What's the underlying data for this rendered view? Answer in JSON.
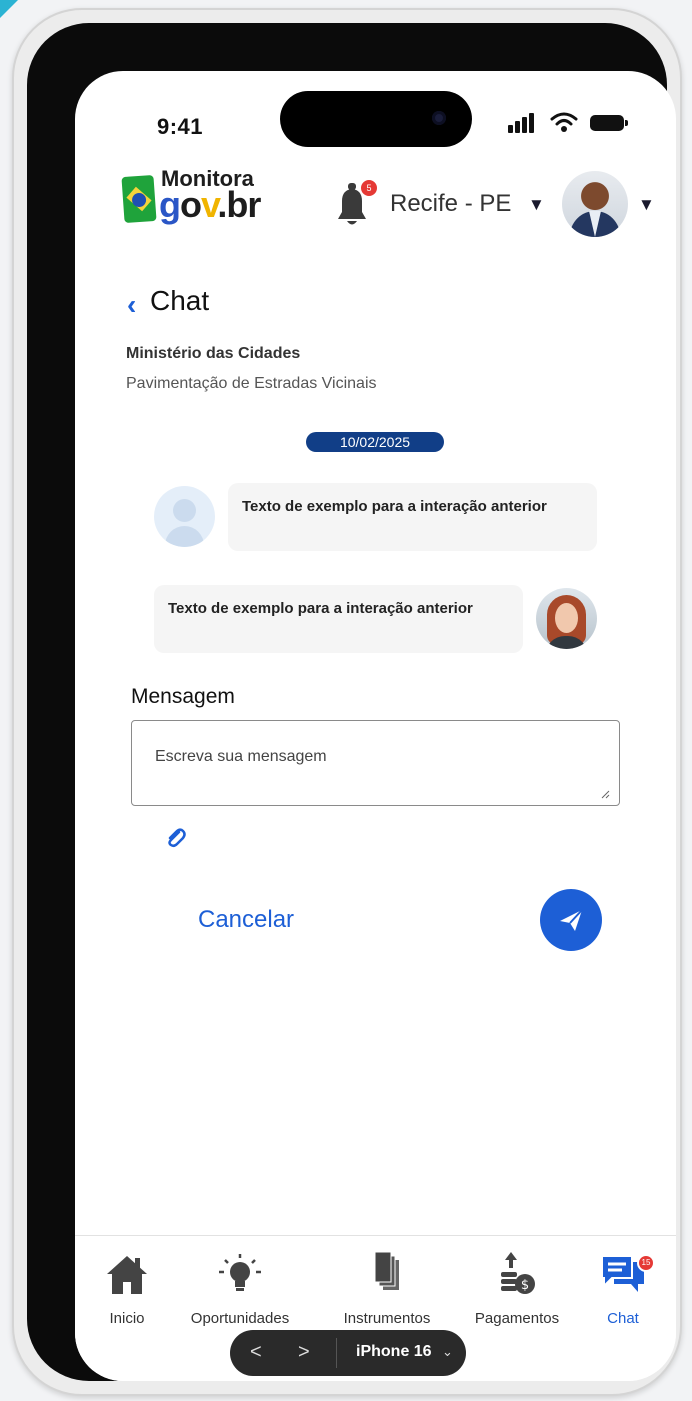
{
  "status_bar": {
    "time": "9:41"
  },
  "header": {
    "logo_top": "Monitora",
    "logo_g": "g",
    "logo_o": "o",
    "logo_v": "v",
    "logo_br": ".br",
    "notification_count": "5",
    "location": "Recife - PE"
  },
  "page": {
    "back_icon": "‹",
    "title": "Chat",
    "organization": "Ministério das Cidades",
    "project": "Pavimentação de Estradas Vicinais"
  },
  "conversation": {
    "date": "10/02/2025",
    "messages": [
      {
        "text": "Texto de exemplo para a interação anterior",
        "sender": "other"
      },
      {
        "text": "Texto de exemplo para a interação anterior",
        "sender": "self"
      }
    ]
  },
  "composer": {
    "label": "Mensagem",
    "placeholder": "Escreva sua mensagem",
    "cancel_label": "Cancelar"
  },
  "tabbar": {
    "items": [
      {
        "label": "Inicio",
        "icon": "home-icon"
      },
      {
        "label": "Oportunidades",
        "icon": "lightbulb-icon"
      },
      {
        "label": "Instrumentos",
        "icon": "documents-icon"
      },
      {
        "label": "Pagamentos",
        "icon": "payments-icon"
      },
      {
        "label": "Chat",
        "icon": "chat-icon"
      }
    ],
    "chat_badge": "15",
    "active": "Chat"
  },
  "device_pill": {
    "prev": "<",
    "next": ">",
    "device": "iPhone 16",
    "chevron": "⌄"
  },
  "colors": {
    "accent": "#1d5fd6",
    "date_pill": "#113e87",
    "badge": "#e53935"
  }
}
